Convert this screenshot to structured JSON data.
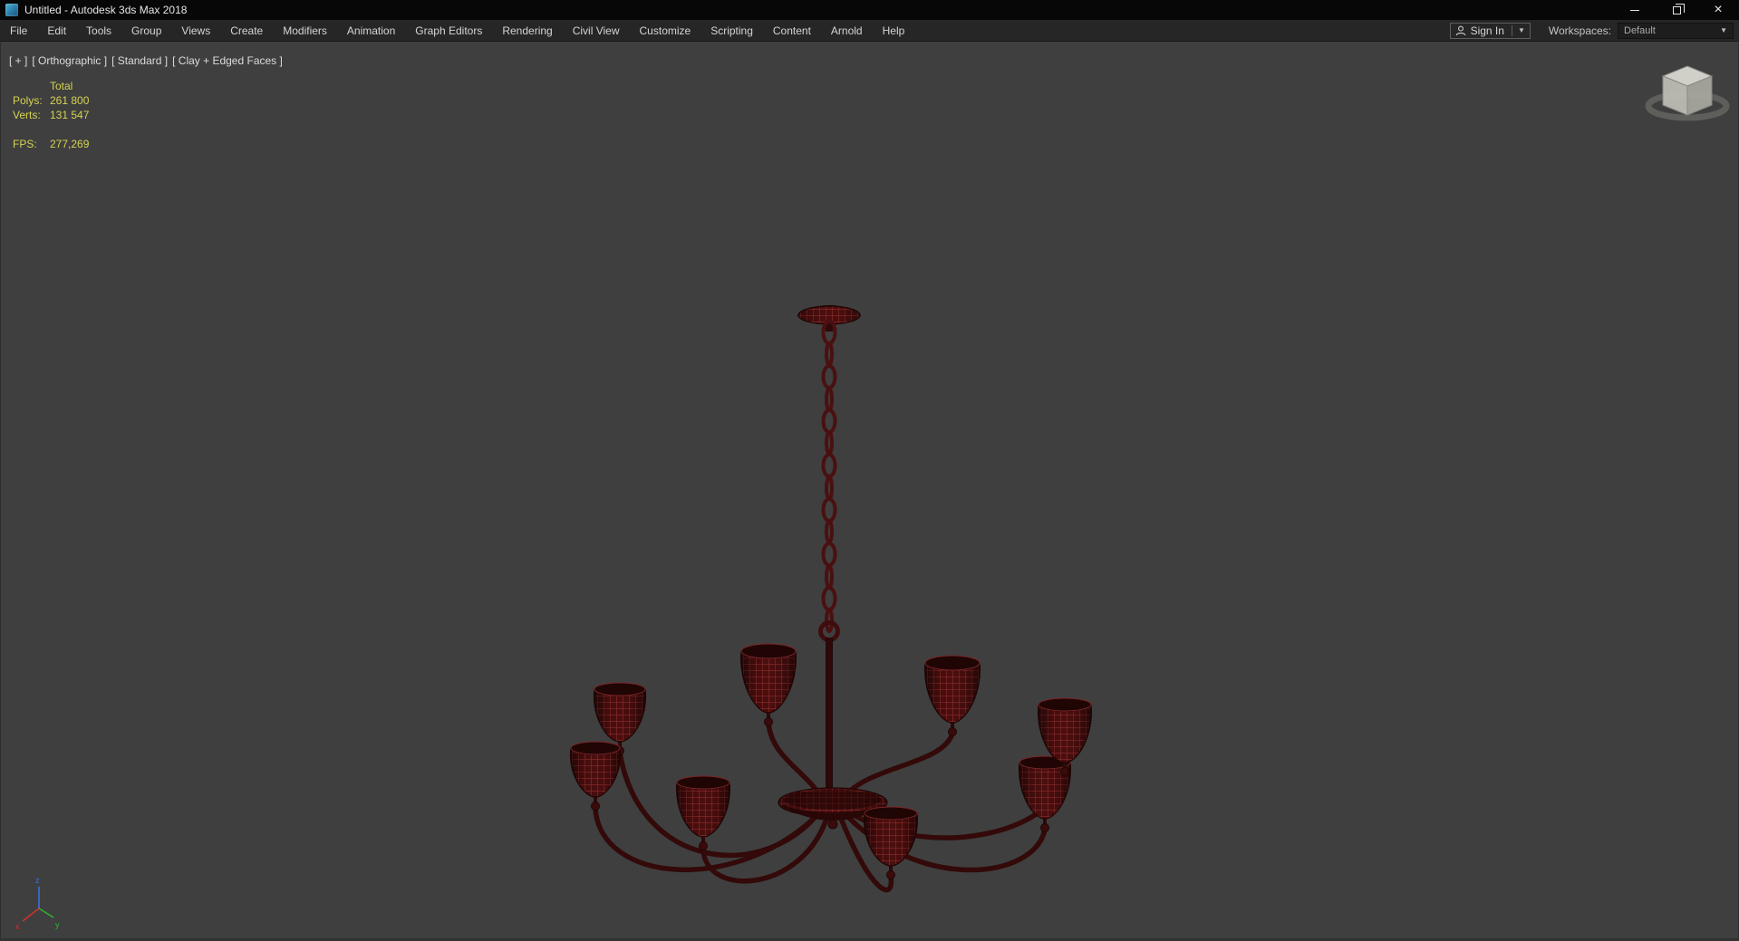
{
  "window": {
    "title": "Untitled - Autodesk 3ds Max 2018"
  },
  "menu_bar": {
    "items": [
      "File",
      "Edit",
      "Tools",
      "Group",
      "Views",
      "Create",
      "Modifiers",
      "Animation",
      "Graph Editors",
      "Rendering",
      "Civil View",
      "Customize",
      "Scripting",
      "Content",
      "Arnold",
      "Help"
    ],
    "sign_in_label": "Sign In",
    "workspaces_label": "Workspaces:",
    "workspace_value": "Default"
  },
  "viewport": {
    "label_parts": [
      "[ + ]",
      "[ Orthographic ]",
      "[ Standard ]",
      "[ Clay + Edged Faces ]"
    ],
    "stats": {
      "total_header": "Total",
      "polys_label": "Polys:",
      "polys_value": "261 800",
      "verts_label": "Verts:",
      "verts_value": "131 547",
      "fps_label": "FPS:",
      "fps_value": "277,269"
    },
    "axis_labels": [
      "x",
      "y",
      "z"
    ]
  },
  "colors": {
    "titlebar_bg": "#070708",
    "menubar_bg": "#262626",
    "viewport_bg": "#3f3f3f",
    "stats_text": "#d6d351",
    "viewport_label_text": "#dcdcdc",
    "model_base": "#3a0b0b",
    "model_wire": "#8f2e2e",
    "model_outline": "#220606",
    "axis_x": "#d03030",
    "axis_y": "#30b030",
    "axis_z": "#3b6fe0"
  }
}
